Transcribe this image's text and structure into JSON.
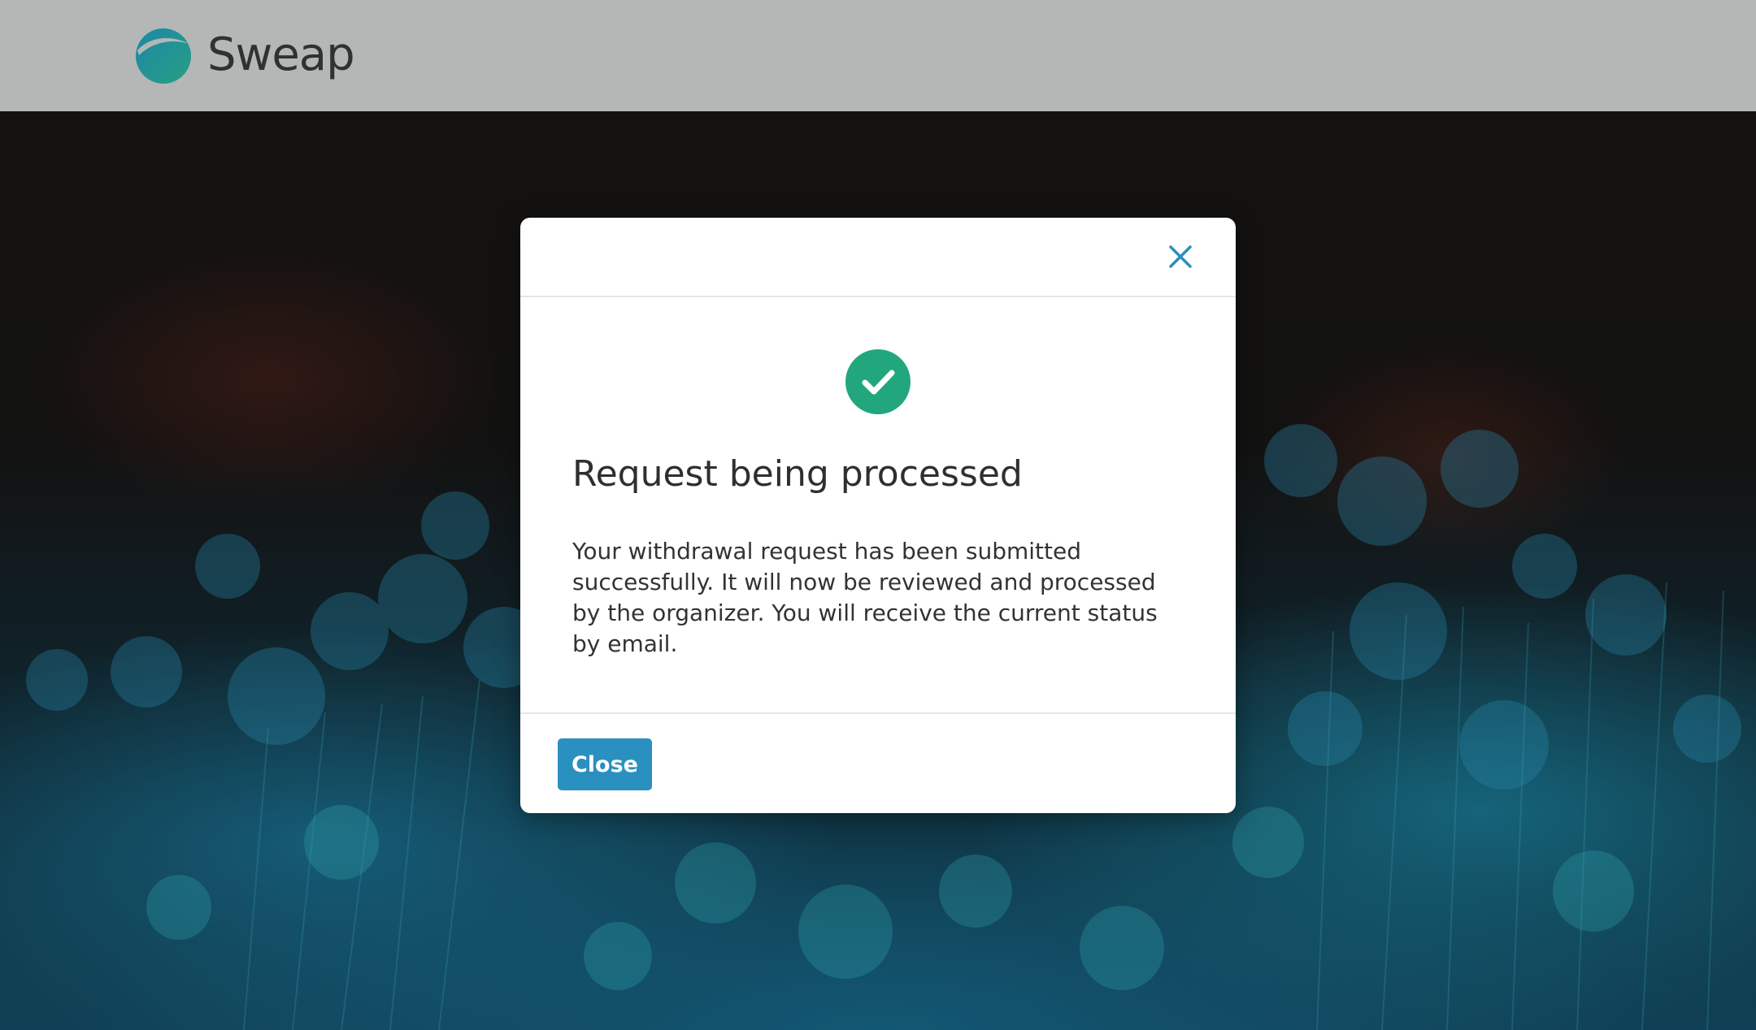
{
  "header": {
    "brand_name": "Sweap",
    "logo_icon": "sweap-logo-icon"
  },
  "colors": {
    "header_bg": "#bfc1c1",
    "accent_blue": "#2a90bf",
    "success_green": "#22a77c",
    "logo_teal": "#1f8fa8"
  },
  "modal": {
    "close_icon": "close-icon",
    "status_icon": "check-circle-icon",
    "title": "Request being processed",
    "body": "Your withdrawal request has been submitted successfully. It will now be reviewed and processed by the organizer. You will receive the current status by email.",
    "close_button_label": "Close"
  }
}
